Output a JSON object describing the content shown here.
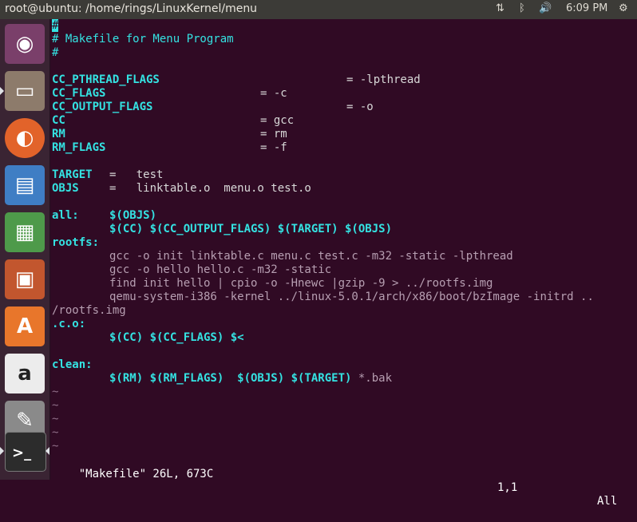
{
  "window": {
    "title": "root@ubuntu: /home/rings/LinuxKernel/menu"
  },
  "indicators": {
    "network_icon": "⇅",
    "bluetooth_icon": "ᛒ",
    "volume_icon": "🔊",
    "time": "6:09 PM",
    "settings_icon": "⚙"
  },
  "launcher": {
    "items": [
      {
        "name": "ubuntu-dash",
        "glyph": "◉"
      },
      {
        "name": "files",
        "glyph": "▭"
      },
      {
        "name": "firefox",
        "glyph": "◐"
      },
      {
        "name": "libreoffice-writer",
        "glyph": "▤"
      },
      {
        "name": "libreoffice-calc",
        "glyph": "▦"
      },
      {
        "name": "libreoffice-impress",
        "glyph": "▣"
      },
      {
        "name": "ubuntu-software",
        "glyph": "A"
      },
      {
        "name": "amazon",
        "glyph": "a"
      },
      {
        "name": "system-settings",
        "glyph": "✎"
      },
      {
        "name": "terminal",
        "glyph": ">_"
      }
    ]
  },
  "editor": {
    "lines": {
      "l0_cursor": "#",
      "l1": "# Makefile for Menu Program",
      "l2": "#",
      "l4_var": "CC_PTHREAD_FLAGS",
      "l4_val": "= -lpthread",
      "l5_var": "CC_FLAGS",
      "l5_val": "= -c",
      "l6_var": "CC_OUTPUT_FLAGS",
      "l6_val": "= -o",
      "l7_var": "CC",
      "l7_val": "= gcc",
      "l8_var": "RM",
      "l8_val": "= rm",
      "l9_var": "RM_FLAGS",
      "l9_val": "= -f",
      "l11_var": "TARGET",
      "l11_val": "=   test",
      "l12_var": "OBJS",
      "l12_val": "=   linktable.o  menu.o test.o",
      "l14_target": "all:",
      "l14_deps": "$(OBJS)",
      "l15_cmd": "$(CC) $(CC_OUTPUT_FLAGS) $(TARGET) $(OBJS)",
      "l16_target": "rootfs:",
      "l17": "gcc -o init linktable.c menu.c test.c -m32 -static -lpthread",
      "l18": "gcc -o hello hello.c -m32 -static",
      "l19": "find init hello | cpio -o -Hnewc |gzip -9 > ../rootfs.img",
      "l20": "qemu-system-i386 -kernel ../linux-5.0.1/arch/x86/boot/bzImage -initrd ..",
      "l21": "/rootfs.img",
      "l22_target": ".c.o:",
      "l23_cmd": "$(CC) $(CC_FLAGS) $<",
      "l25_target": "clean:",
      "l26_cmd": "$(RM) $(RM_FLAGS)  $(OBJS) $(TARGET)",
      "l26_rest": " *.bak",
      "tilde": "~"
    },
    "status": {
      "file": "\"Makefile\" 26L, 673C",
      "position": "1,1",
      "scroll": "All"
    }
  },
  "colors": {
    "background": "#300a24",
    "comment": "#34e2e2",
    "text": "#d8d8d8",
    "tilde": "#8f6e88"
  }
}
